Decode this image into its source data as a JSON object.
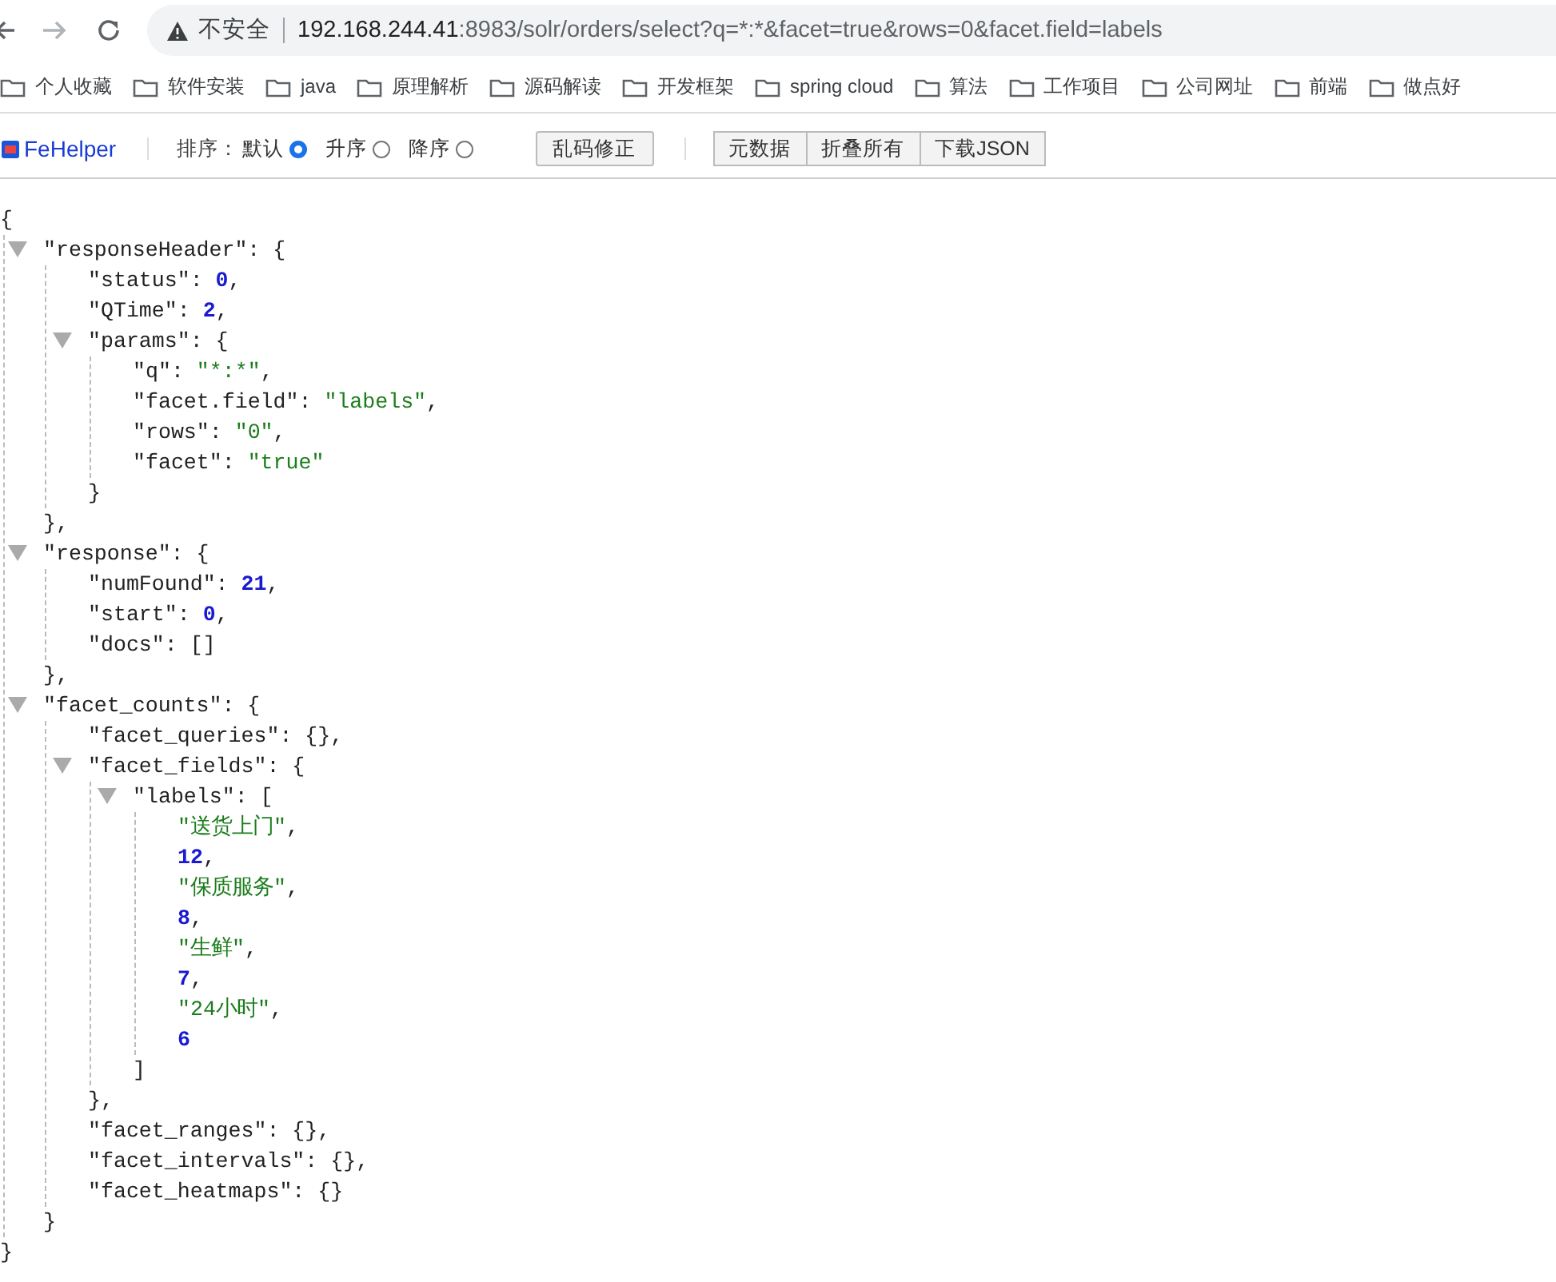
{
  "address_bar": {
    "security": "不安全",
    "host": "192.168.244.41",
    "path": ":8983/solr/orders/select?q=*:*&facet=true&rows=0&facet.field=labels"
  },
  "bookmarks": [
    {
      "label": "个人收藏"
    },
    {
      "label": "软件安装"
    },
    {
      "label": "java"
    },
    {
      "label": "原理解析"
    },
    {
      "label": "源码解读"
    },
    {
      "label": "开发框架"
    },
    {
      "label": "spring cloud"
    },
    {
      "label": "算法"
    },
    {
      "label": "工作项目"
    },
    {
      "label": "公司网址"
    },
    {
      "label": "前端"
    },
    {
      "label": "做点好"
    }
  ],
  "fehelper_toolbar": {
    "logo": "FeHelper",
    "sort_label": "排序：",
    "sort_options": [
      {
        "label": "默认",
        "selected": true
      },
      {
        "label": "升序",
        "selected": false
      },
      {
        "label": "降序",
        "selected": false
      }
    ],
    "fix_button": "乱码修正",
    "buttons": [
      "元数据",
      "折叠所有",
      "下载JSON"
    ]
  },
  "json_view": {
    "open": "{",
    "close": "}",
    "children": [
      {
        "key": "\"responseHeader\": ",
        "open": "{",
        "close": "},",
        "expanded": true,
        "children": [
          {
            "key": "\"status\": ",
            "kind": "number",
            "value": "0",
            "tail": ","
          },
          {
            "key": "\"QTime\": ",
            "kind": "number",
            "value": "2",
            "tail": ","
          },
          {
            "key": "\"params\": ",
            "open": "{",
            "close": "}",
            "expanded": true,
            "children": [
              {
                "key": "\"q\": ",
                "kind": "string",
                "value": "\"*:*\"",
                "tail": ","
              },
              {
                "key": "\"facet.field\": ",
                "kind": "string",
                "value": "\"labels\"",
                "tail": ","
              },
              {
                "key": "\"rows\": ",
                "kind": "string",
                "value": "\"0\"",
                "tail": ","
              },
              {
                "key": "\"facet\": ",
                "kind": "string",
                "value": "\"true\""
              }
            ]
          }
        ]
      },
      {
        "key": "\"response\": ",
        "open": "{",
        "close": "},",
        "expanded": true,
        "children": [
          {
            "key": "\"numFound\": ",
            "kind": "number",
            "value": "21",
            "tail": ","
          },
          {
            "key": "\"start\": ",
            "kind": "number",
            "value": "0",
            "tail": ","
          },
          {
            "key": "\"docs\": ",
            "kind": "empty",
            "value": "[]"
          }
        ]
      },
      {
        "key": "\"facet_counts\": ",
        "open": "{",
        "close": "}",
        "expanded": true,
        "children": [
          {
            "key": "\"facet_queries\": ",
            "kind": "empty",
            "value": "{}",
            "tail": ","
          },
          {
            "key": "\"facet_fields\": ",
            "open": "{",
            "close": "},",
            "expanded": true,
            "children": [
              {
                "key": "\"labels\": ",
                "open": "[",
                "close": "]",
                "expanded": true,
                "children": [
                  {
                    "kind": "string",
                    "value": "\"送货上门\"",
                    "tail": ","
                  },
                  {
                    "kind": "number",
                    "value": "12",
                    "tail": ","
                  },
                  {
                    "kind": "string",
                    "value": "\"保质服务\"",
                    "tail": ","
                  },
                  {
                    "kind": "number",
                    "value": "8",
                    "tail": ","
                  },
                  {
                    "kind": "string",
                    "value": "\"生鲜\"",
                    "tail": ","
                  },
                  {
                    "kind": "number",
                    "value": "7",
                    "tail": ","
                  },
                  {
                    "kind": "string",
                    "value": "\"24小时\"",
                    "tail": ","
                  },
                  {
                    "kind": "number",
                    "value": "6"
                  }
                ]
              }
            ]
          },
          {
            "key": "\"facet_ranges\": ",
            "kind": "empty",
            "value": "{}",
            "tail": ","
          },
          {
            "key": "\"facet_intervals\": ",
            "kind": "empty",
            "value": "{}",
            "tail": ","
          },
          {
            "key": "\"facet_heatmaps\": ",
            "kind": "empty",
            "value": "{}"
          }
        ]
      }
    ]
  }
}
